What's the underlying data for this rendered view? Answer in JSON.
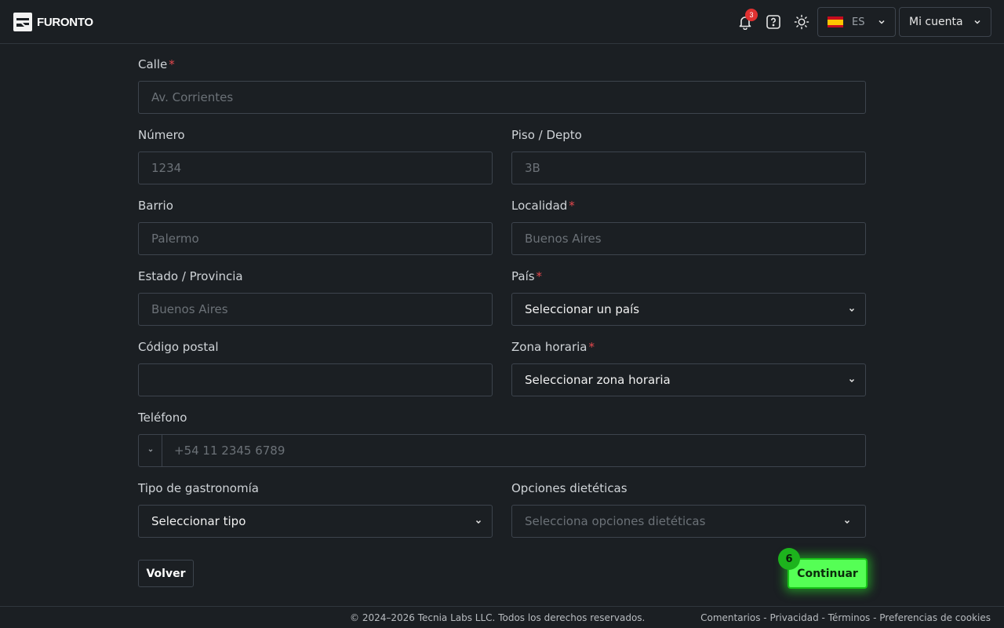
{
  "header": {
    "brand": "FURONTO",
    "notifications_count": "3",
    "language_code": "ES",
    "account_label": "Mi cuenta"
  },
  "form": {
    "street": {
      "label": "Calle",
      "placeholder": "Av. Corrientes",
      "required": true
    },
    "number": {
      "label": "Número",
      "placeholder": "1234"
    },
    "floor": {
      "label": "Piso / Depto",
      "placeholder": "3B"
    },
    "neighborhood": {
      "label": "Barrio",
      "placeholder": "Palermo"
    },
    "locality": {
      "label": "Localidad",
      "placeholder": "Buenos Aires",
      "required": true
    },
    "state": {
      "label": "Estado / Provincia",
      "placeholder": "Buenos Aires"
    },
    "country": {
      "label": "País",
      "value": "Seleccionar un país",
      "required": true
    },
    "postal_code": {
      "label": "Código postal",
      "value": ""
    },
    "timezone": {
      "label": "Zona horaria",
      "value": "Seleccionar zona horaria",
      "required": true
    },
    "phone": {
      "label": "Teléfono",
      "placeholder": "+54 11 2345 6789"
    },
    "cuisine": {
      "label": "Tipo de gastronomía",
      "value": "Seleccionar tipo"
    },
    "dietary": {
      "label": "Opciones dietéticas",
      "placeholder": "Selecciona opciones dietéticas"
    },
    "required_mark": "*"
  },
  "actions": {
    "back_label": "Volver",
    "continue_label": "Continuar",
    "step_badge": "6"
  },
  "footer": {
    "copyright": "© 2024–2026 Tecnia Labs LLC. Todos los derechos reservados.",
    "links": [
      "Comentarios",
      "Privacidad",
      "Términos",
      "Preferencias de cookies"
    ],
    "separator": " - "
  },
  "colors": {
    "background": "#1b1f23",
    "accent_button": "#55ff55",
    "required": "#e5484d",
    "badge": "#e03131"
  }
}
